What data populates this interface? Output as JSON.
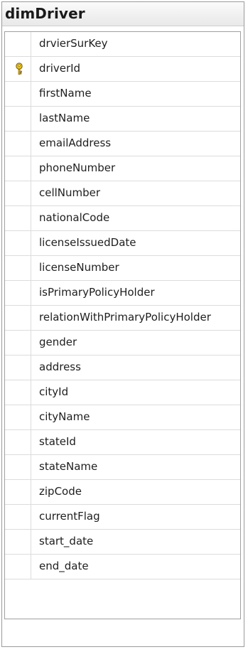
{
  "table": {
    "title": "dimDriver",
    "columns": [
      {
        "name": "drvierSurKey",
        "primary_key": false
      },
      {
        "name": "driverId",
        "primary_key": true
      },
      {
        "name": "firstName",
        "primary_key": false
      },
      {
        "name": "lastName",
        "primary_key": false
      },
      {
        "name": "emailAddress",
        "primary_key": false
      },
      {
        "name": "phoneNumber",
        "primary_key": false
      },
      {
        "name": "cellNumber",
        "primary_key": false
      },
      {
        "name": "nationalCode",
        "primary_key": false
      },
      {
        "name": "licenseIssuedDate",
        "primary_key": false
      },
      {
        "name": "licenseNumber",
        "primary_key": false
      },
      {
        "name": "isPrimaryPolicyHolder",
        "primary_key": false
      },
      {
        "name": "relationWithPrimaryPolicyHolder",
        "primary_key": false
      },
      {
        "name": "gender",
        "primary_key": false
      },
      {
        "name": "address",
        "primary_key": false
      },
      {
        "name": "cityId",
        "primary_key": false
      },
      {
        "name": "cityName",
        "primary_key": false
      },
      {
        "name": "stateId",
        "primary_key": false
      },
      {
        "name": "stateName",
        "primary_key": false
      },
      {
        "name": "zipCode",
        "primary_key": false
      },
      {
        "name": "currentFlag",
        "primary_key": false
      },
      {
        "name": "start_date",
        "primary_key": false
      },
      {
        "name": "end_date",
        "primary_key": false
      }
    ]
  },
  "icons": {
    "primary_key": "key-icon"
  },
  "colors": {
    "key_gold": "#e8c21a",
    "key_outline": "#7a5a00"
  }
}
